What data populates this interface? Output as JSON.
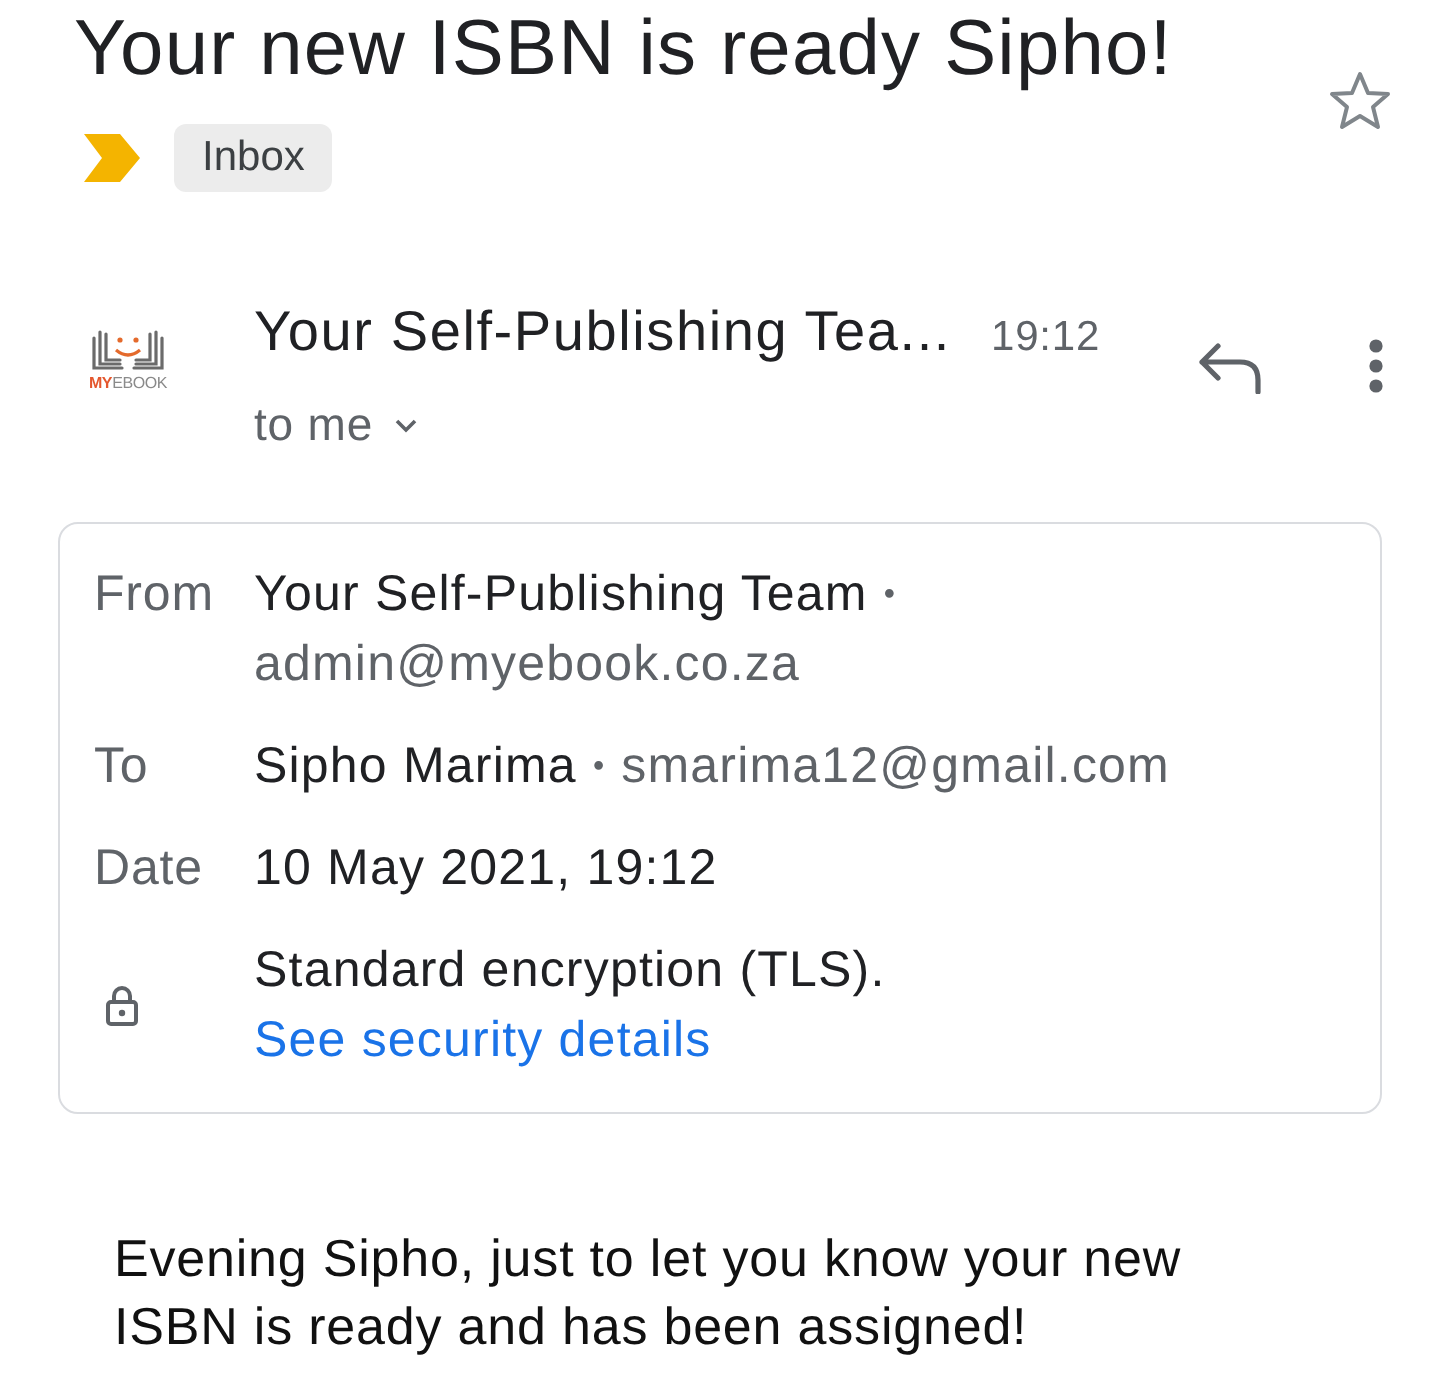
{
  "subject": "Your new ISBN is ready Sipho!",
  "starred": false,
  "important": true,
  "labels": [
    {
      "text": "Inbox"
    }
  ],
  "sender": {
    "logo": {
      "accent": "MY",
      "rest": "EBOOK"
    },
    "name": "Your Self-Publishing Tea...",
    "time": "19:12",
    "recipients": "to me"
  },
  "details": [
    {
      "kind": "contact",
      "label": "From",
      "name": "Your Self-Publishing Team",
      "separator": "•",
      "address": "admin@myebook.co.za"
    },
    {
      "kind": "contact",
      "label": "To",
      "name": "Sipho Marima",
      "separator": "•",
      "address": "smarima12@gmail.com"
    },
    {
      "kind": "text",
      "label": "Date",
      "value": "10 May 2021, 19:12"
    },
    {
      "kind": "security",
      "text": "Standard encryption (TLS).",
      "link": "See security details"
    }
  ],
  "body": [
    "Evening Sipho, just to let you know your new ISBN is ready and has been assigned!"
  ]
}
